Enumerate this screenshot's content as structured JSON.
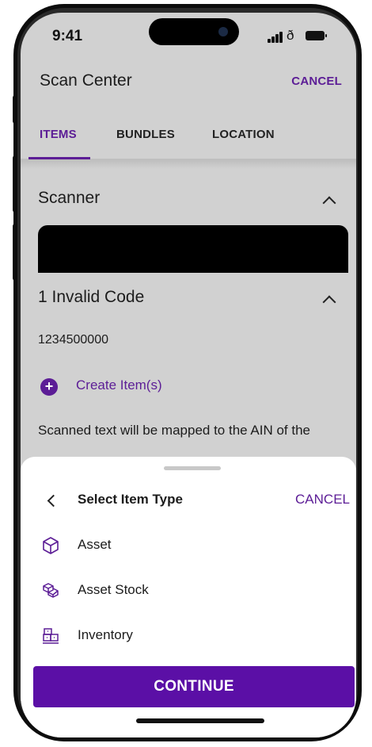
{
  "status_bar": {
    "time": "9:41"
  },
  "header": {
    "title": "Scan Center",
    "cancel_label": "CANCEL"
  },
  "tabs": [
    {
      "label": "ITEMS",
      "active": true
    },
    {
      "label": "BUNDLES",
      "active": false
    },
    {
      "label": "LOCATION",
      "active": false
    }
  ],
  "scanner_section": {
    "title": "Scanner"
  },
  "invalid_section": {
    "title": "1 Invalid Code",
    "code": "1234500000",
    "create_label": "Create Item(s)",
    "info_text": "Scanned text will be mapped to the AIN of the"
  },
  "sheet": {
    "title": "Select Item Type",
    "cancel_label": "CANCEL",
    "items": [
      {
        "label": "Asset",
        "icon": "cube-icon"
      },
      {
        "label": "Asset Stock",
        "icon": "cubes-stack-icon"
      },
      {
        "label": "Inventory",
        "icon": "inventory-boxes-icon"
      }
    ],
    "continue_label": "CONTINUE"
  },
  "colors": {
    "accent": "#5c1d96",
    "button": "#5b0fa6",
    "overlay": "#d1d1d1"
  }
}
